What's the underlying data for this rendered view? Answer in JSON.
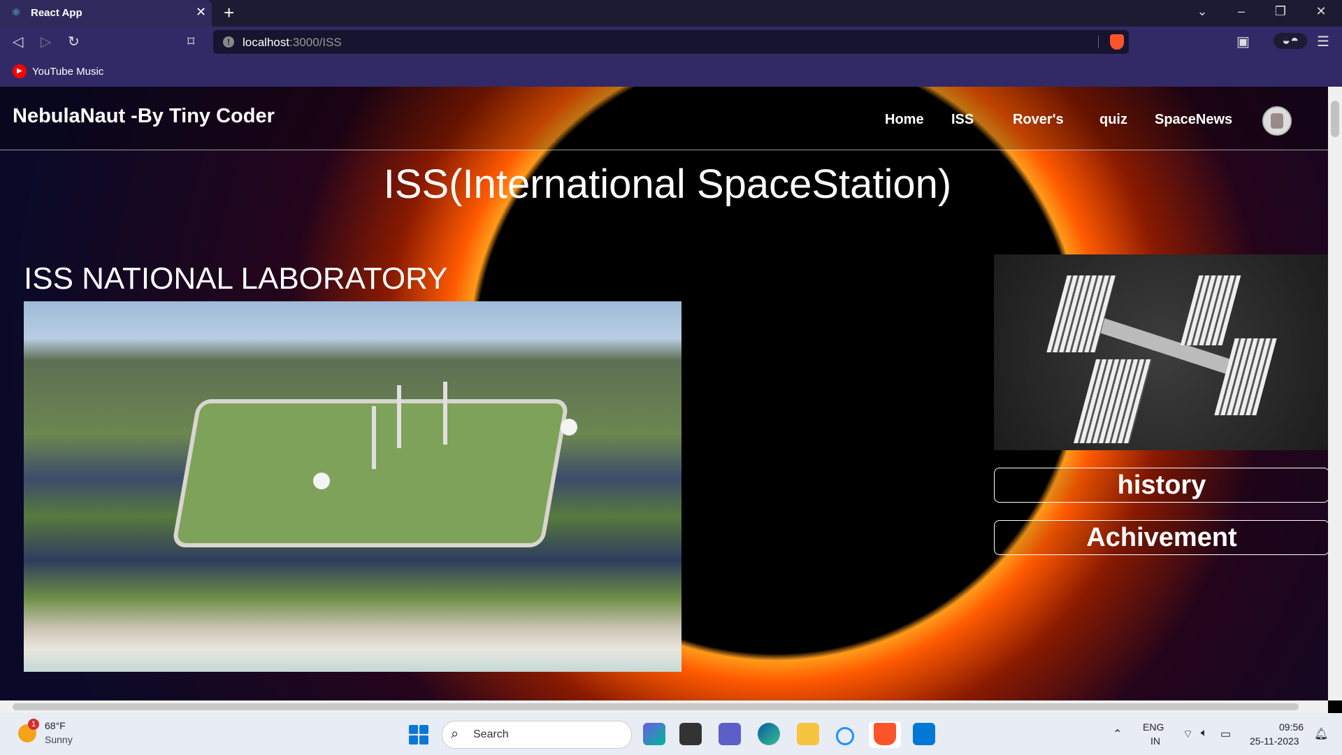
{
  "browser": {
    "tab_title": "React App",
    "url_host": "localhost",
    "url_path": ":3000/ISS",
    "bookmark_label": "YouTube Music"
  },
  "site": {
    "brand": "NebulaNaut -By Tiny Coder",
    "nav": [
      "Home",
      "ISS",
      "Rover's",
      "quiz",
      "SpaceNews"
    ],
    "heading": "ISS(International SpaceStation)",
    "section_title": "ISS NATIONAL LABORATORY",
    "buttons": [
      "history",
      "Achivement"
    ]
  },
  "taskbar": {
    "weather_temp": "68°F",
    "weather_condition": "Sunny",
    "weather_badge": "1",
    "search_label": "Search",
    "lang_line1": "ENG",
    "lang_line2": "IN",
    "time": "09:56",
    "date": "25-11-2023"
  },
  "icons": [
    "react-icon",
    "close-icon",
    "plus-icon",
    "chevron-down-icon",
    "minimize-icon",
    "restore-icon",
    "back-icon",
    "forward-icon",
    "reload-icon",
    "bookmark-icon",
    "info-icon",
    "brave-shield-icon",
    "sidebar-icon",
    "vpn-icon",
    "menu-icon",
    "youtube-music-icon",
    "windows-start-icon",
    "search-icon",
    "wifi-icon",
    "volume-icon",
    "battery-icon",
    "notification-icon"
  ],
  "colors": {
    "tabbar": "#1c1b33",
    "toolbar": "#312a66",
    "accent_eclipse": "#ff9a1a"
  }
}
